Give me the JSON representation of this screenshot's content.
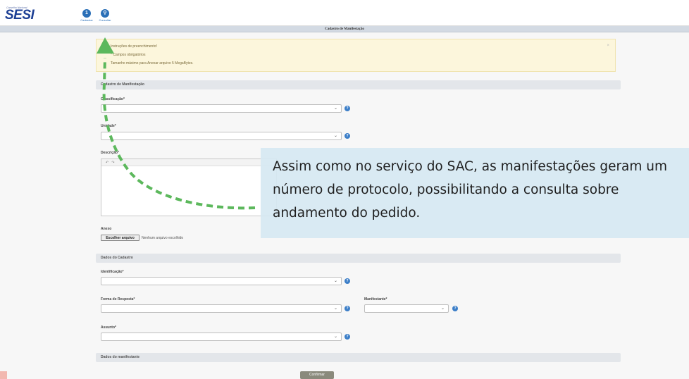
{
  "brand": {
    "small_text": "Conselho Nacional",
    "logo": "SESI"
  },
  "nav": [
    {
      "label": "Cadastrar",
      "icon": "cadastrar-icon",
      "glyph": "1"
    },
    {
      "label": "Consultar",
      "icon": "search-icon",
      "glyph": "⚲"
    }
  ],
  "page_title": "Cadastro de Manifestação",
  "alert": {
    "lines": [
      "Instruções de preenchimento!",
      "* Campos obrigatórios",
      "Tamanho máximo para Anexar arquivo 5 MegaBytes."
    ],
    "close": "×"
  },
  "section1": {
    "title": "Cadastro de Manifestação"
  },
  "fields": {
    "classificacao": "Classificação*",
    "unidade": "Unidade*",
    "descricao": "Descrição*",
    "identificacao": "Identificação*",
    "forma_resposta": "Forma de Resposta*",
    "manifestante": "Manifestante*",
    "assunto": "Assunto*"
  },
  "editor": {
    "undo": "↶",
    "redo": "↷"
  },
  "anexo": {
    "label": "Anexo",
    "button": "Escolher arquivo",
    "status": "Nenhum arquivo escolhido"
  },
  "section2": {
    "title": "Dados do Cadastro"
  },
  "section3": {
    "title": "Dados do manifestante"
  },
  "submit": "Confirmar",
  "callout": "Assim como no serviço do SAC, as manifestações geram um  número de protocolo, possibilitando a consulta sobre andamento do pedido.",
  "colors": {
    "accent": "#2a6fb7",
    "arrow": "#5cb85c",
    "callout_bg": "#d6e8f2",
    "alert_bg": "#fcf6dc"
  }
}
